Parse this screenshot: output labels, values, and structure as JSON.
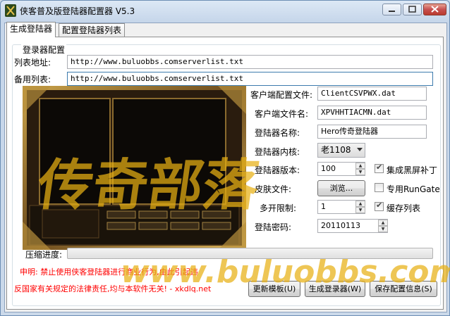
{
  "window": {
    "title": "侠客普及版登陆器配置器 V5.3"
  },
  "tabs": [
    {
      "label": "生成登陆器",
      "active": true
    },
    {
      "label": "配置登陆器列表",
      "active": false
    }
  ],
  "group": {
    "title": "登录器配置"
  },
  "list": {
    "list_label": "列表地址:",
    "list_value": "http://www.buluobbs.comserverlist.txt",
    "backup_label": "备用列表:",
    "backup_value": "http://www.buluobbs.comserverlist.txt"
  },
  "config": {
    "client_config_label": "客户端配置文件:",
    "client_config_value": "ClientCSVPWX.dat",
    "client_file_label": "客户端文件名:",
    "client_file_value": "XPVHHTIACMN.dat",
    "name_label": "登陆器名称:",
    "name_value": "Hero传奇登陆器",
    "core_label": "登陆器内核:",
    "core_value": "老1108",
    "version_label": "登陆器版本:",
    "version_value": "100",
    "skin_label": "皮肤文件:",
    "skin_button": "浏览...",
    "multi_label": "多开限制:",
    "multi_value": "1",
    "password_label": "登陆密码:",
    "password_value": "20110113"
  },
  "checks": {
    "blackscreen_label": "集成黑屏补丁",
    "blackscreen_checked": true,
    "rungate_label": "专用RunGate",
    "rungate_checked": false,
    "cache_label": "缓存列表",
    "cache_checked": true
  },
  "progress": {
    "label": "压缩进度:",
    "value": 0
  },
  "notice": {
    "line1": "申明: 禁止使用侠客登陆器进行商业行为,由此引起违",
    "line2": "反国家有关规定的法律责任,均与本软件无关! - xkdlq.net"
  },
  "buttons": {
    "update_template": "更新模板(U)",
    "generate": "生成登录器(W)",
    "save_config": "保存配置信息(S)"
  },
  "watermark": {
    "big": "传奇部落",
    "url": "www.buluobbs.com"
  },
  "colors": {
    "notice_red": "#ff0000",
    "watermark": "#e8b014"
  }
}
